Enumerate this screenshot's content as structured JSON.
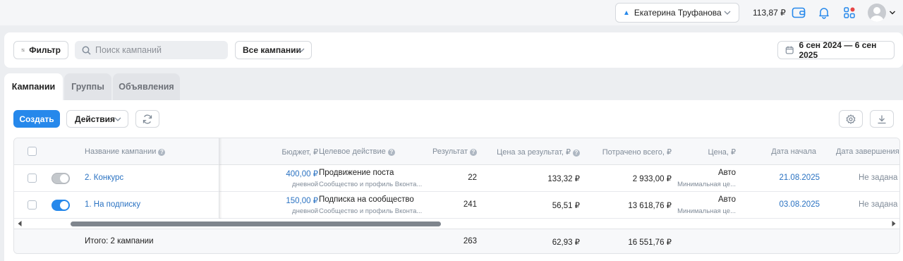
{
  "header": {
    "user_name": "Екатерина Труфанова",
    "balance": "113,87 ₽"
  },
  "filters": {
    "filter_label": "Фильтр",
    "search_placeholder": "Поиск кампаний",
    "campaign_filter": "Все кампании",
    "date_range": "6 сен 2024 — 6 сен 2025"
  },
  "tabs": [
    {
      "label": "Кампании"
    },
    {
      "label": "Группы"
    },
    {
      "label": "Объявления"
    }
  ],
  "toolbar": {
    "create_label": "Создать",
    "actions_label": "Действия"
  },
  "table": {
    "columns": {
      "name": "Название кампании",
      "budget": "Бюджет, ₽",
      "target": "Целевое действие",
      "result": "Результат",
      "cost_per_result": "Цена за результат, ₽",
      "spent": "Потрачено всего, ₽",
      "price": "Цена, ₽",
      "start": "Дата начала",
      "end": "Дата завершения"
    },
    "rows": [
      {
        "name": "2. Конкурс",
        "enabled": false,
        "budget": "400,00 ₽",
        "budget_type": "дневной",
        "target": "Продвижение поста",
        "target_sub": "Сообщество и профиль Вконта...",
        "result": "22",
        "cost_per_result": "133,32 ₽",
        "spent": "2 933,00 ₽",
        "price": "Авто",
        "price_sub": "Минимальная це...",
        "start": "21.08.2025",
        "end": "Не задана"
      },
      {
        "name": "1. На подписку",
        "enabled": true,
        "budget": "150,00 ₽",
        "budget_type": "дневной",
        "target": "Подписка на сообщество",
        "target_sub": "Сообщество и профиль Вконта...",
        "result": "241",
        "cost_per_result": "56,51 ₽",
        "spent": "13 618,76 ₽",
        "price": "Авто",
        "price_sub": "Минимальная це...",
        "start": "03.08.2025",
        "end": "Не задана"
      }
    ],
    "totals": {
      "label": "Итого: 2 кампании",
      "result": "263",
      "cost_per_result": "62,93 ₽",
      "spent": "16 551,76 ₽"
    }
  },
  "colors": {
    "accent": "#2688eb",
    "link": "#2a72c2",
    "background": "#eceef1"
  }
}
